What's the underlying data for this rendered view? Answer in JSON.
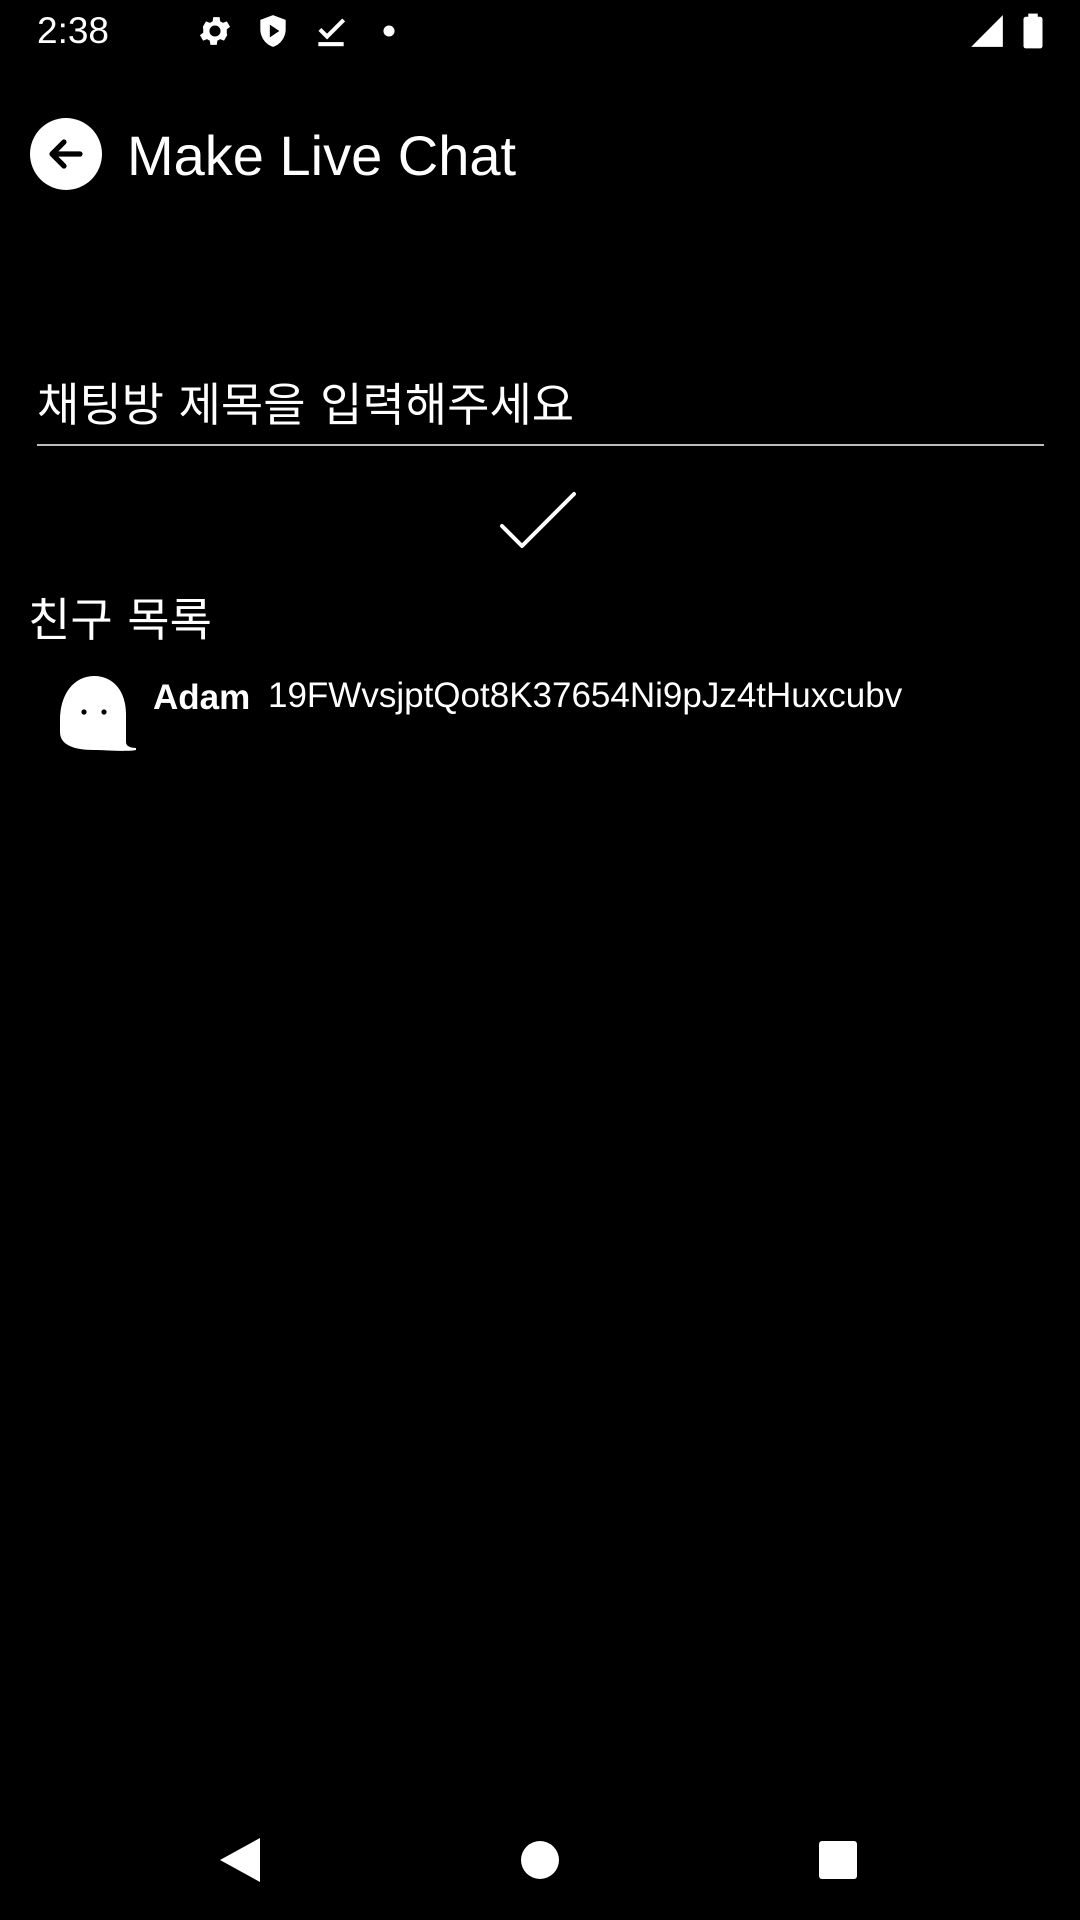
{
  "status_bar": {
    "time": "2:38",
    "icons": [
      "settings-icon",
      "shield-icon",
      "download-done-icon",
      "notification-dot-icon",
      "signal-icon",
      "battery-icon"
    ]
  },
  "app_bar": {
    "back_icon": "arrow-back-icon",
    "title": "Make Live Chat"
  },
  "chat_form": {
    "title_placeholder": "채팅방 제목을 입력해주세요",
    "title_value": "",
    "confirm_icon": "check-icon"
  },
  "friends": {
    "label": "친구 목록",
    "items": [
      {
        "avatar_icon": "ghost-avatar-icon",
        "name": "Adam",
        "id": "19FWvsjptQot8K37654Ni9pJz4tHuxcubv"
      }
    ]
  },
  "nav_bar": {
    "buttons": [
      "back-triangle-icon",
      "home-circle-icon",
      "recents-square-icon"
    ]
  },
  "colors": {
    "background": "#000000",
    "foreground": "#ffffff",
    "divider": "#bdbdbd"
  }
}
